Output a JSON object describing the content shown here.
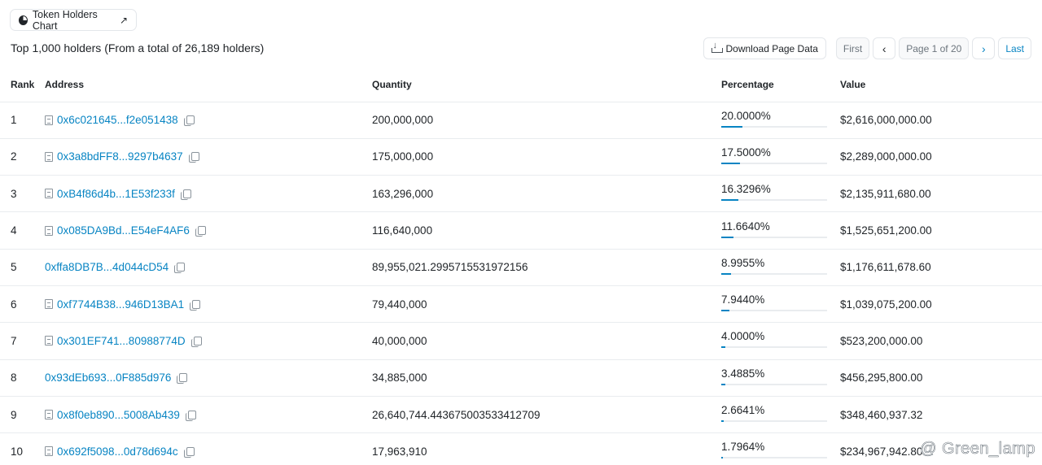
{
  "chart_button": {
    "label": "Token Holders Chart",
    "external_icon": "↗"
  },
  "summary": "Top 1,000 holders (From a total of 26,189 holders)",
  "toolbar": {
    "download_label": "Download Page Data",
    "first_label": "First",
    "prev_icon": "‹",
    "page_label": "Page 1 of 20",
    "next_icon": "›",
    "last_label": "Last"
  },
  "columns": {
    "rank": "Rank",
    "address": "Address",
    "quantity": "Quantity",
    "percentage": "Percentage",
    "value": "Value"
  },
  "rows": [
    {
      "rank": "1",
      "address": "0x6c021645...f2e051438",
      "contract": true,
      "quantity": "200,000,000",
      "percentage": "20.0000%",
      "pct": 0.2,
      "value": "$2,616,000,000.00"
    },
    {
      "rank": "2",
      "address": "0x3a8bdFF8...9297b4637",
      "contract": true,
      "quantity": "175,000,000",
      "percentage": "17.5000%",
      "pct": 0.175,
      "value": "$2,289,000,000.00"
    },
    {
      "rank": "3",
      "address": "0xB4f86d4b...1E53f233f",
      "contract": true,
      "quantity": "163,296,000",
      "percentage": "16.3296%",
      "pct": 0.163296,
      "value": "$2,135,911,680.00"
    },
    {
      "rank": "4",
      "address": "0x085DA9Bd...E54eF4AF6",
      "contract": true,
      "quantity": "116,640,000",
      "percentage": "11.6640%",
      "pct": 0.11664,
      "value": "$1,525,651,200.00"
    },
    {
      "rank": "5",
      "address": "0xffa8DB7B...4d044cD54",
      "contract": false,
      "quantity": "89,955,021.2995715531972156",
      "percentage": "8.9955%",
      "pct": 0.089955,
      "value": "$1,176,611,678.60"
    },
    {
      "rank": "6",
      "address": "0xf7744B38...946D13BA1",
      "contract": true,
      "quantity": "79,440,000",
      "percentage": "7.9440%",
      "pct": 0.07944,
      "value": "$1,039,075,200.00"
    },
    {
      "rank": "7",
      "address": "0x301EF741...80988774D",
      "contract": true,
      "quantity": "40,000,000",
      "percentage": "4.0000%",
      "pct": 0.04,
      "value": "$523,200,000.00"
    },
    {
      "rank": "8",
      "address": "0x93dEb693...0F885d976",
      "contract": false,
      "quantity": "34,885,000",
      "percentage": "3.4885%",
      "pct": 0.034885,
      "value": "$456,295,800.00"
    },
    {
      "rank": "9",
      "address": "0x8f0eb890...5008Ab439",
      "contract": true,
      "quantity": "26,640,744.443675003533412709",
      "percentage": "2.6641%",
      "pct": 0.026641,
      "value": "$348,460,937.32"
    },
    {
      "rank": "10",
      "address": "0x692f5098...0d78d694c",
      "contract": true,
      "quantity": "17,963,910",
      "percentage": "1.7964%",
      "pct": 0.017964,
      "value": "$234,967,942.80"
    }
  ],
  "watermark": "@ Green_lamp",
  "colors": {
    "link": "#0784c3",
    "bar_track": "#e9ecef"
  }
}
